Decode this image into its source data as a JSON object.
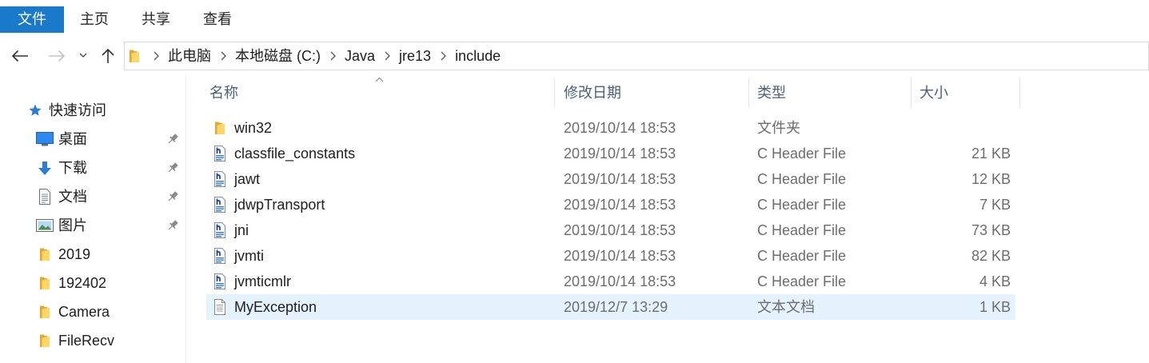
{
  "ribbon": {
    "tabs": [
      {
        "label": "文件",
        "active": true
      },
      {
        "label": "主页",
        "active": false
      },
      {
        "label": "共享",
        "active": false
      },
      {
        "label": "查看",
        "active": false
      }
    ]
  },
  "address_bar": {
    "back_icon": "arrow-left-icon",
    "forward_icon": "arrow-right-icon",
    "forward_enabled": false,
    "recent_locations_icon": "chevron-down-icon",
    "up_icon": "arrow-up-icon",
    "location_icon": "folder-icon",
    "separator_icon": "chevron-right-icon",
    "breadcrumbs": [
      "此电脑",
      "本地磁盘 (C:)",
      "Java",
      "jre13",
      "include"
    ]
  },
  "nav_pane": {
    "quick_access": {
      "label": "快速访问",
      "icon": "star-icon"
    },
    "pin_icon": "pin-icon",
    "items": [
      {
        "label": "桌面",
        "icon": "desktop-icon",
        "pinned": true
      },
      {
        "label": "下载",
        "icon": "download-icon",
        "pinned": true
      },
      {
        "label": "文档",
        "icon": "documents-icon",
        "pinned": true
      },
      {
        "label": "图片",
        "icon": "pictures-icon",
        "pinned": true
      },
      {
        "label": "2019",
        "icon": "folder-icon",
        "pinned": false
      },
      {
        "label": "192402",
        "icon": "folder-icon",
        "pinned": false
      },
      {
        "label": "Camera",
        "icon": "folder-icon",
        "pinned": false
      },
      {
        "label": "FileRecv",
        "icon": "folder-icon",
        "pinned": false
      }
    ]
  },
  "file_list": {
    "sort_icon": "sort-ascending-icon",
    "columns": {
      "name": "名称",
      "modified": "修改日期",
      "type": "类型",
      "size": "大小"
    },
    "files": [
      {
        "name": "win32",
        "modified": "2019/10/14 18:53",
        "type": "文件夹",
        "icon": "folder-icon"
      },
      {
        "name": "classfile_constants",
        "modified": "2019/10/14 18:53",
        "type": "C Header File",
        "size": "21 KB",
        "icon": "header-file-icon"
      },
      {
        "name": "jawt",
        "modified": "2019/10/14 18:53",
        "type": "C Header File",
        "size": "12 KB",
        "icon": "header-file-icon"
      },
      {
        "name": "jdwpTransport",
        "modified": "2019/10/14 18:53",
        "type": "C Header File",
        "size": "7 KB",
        "icon": "header-file-icon"
      },
      {
        "name": "jni",
        "modified": "2019/10/14 18:53",
        "type": "C Header File",
        "size": "73 KB",
        "icon": "header-file-icon"
      },
      {
        "name": "jvmti",
        "modified": "2019/10/14 18:53",
        "type": "C Header File",
        "size": "82 KB",
        "icon": "header-file-icon"
      },
      {
        "name": "jvmticmlr",
        "modified": "2019/10/14 18:53",
        "type": "C Header File",
        "size": "4 KB",
        "icon": "header-file-icon"
      },
      {
        "name": "MyException",
        "modified": "2019/12/7 13:29",
        "type": "文本文档",
        "size": "1 KB",
        "icon": "text-file-icon",
        "highlighted": true
      }
    ]
  },
  "colors": {
    "accent": "#1979ca",
    "row_highlight": "#e5f3ff",
    "folder": "#ffd766",
    "header_text": "#4c607a",
    "secondary_text": "#6d6d6d"
  }
}
